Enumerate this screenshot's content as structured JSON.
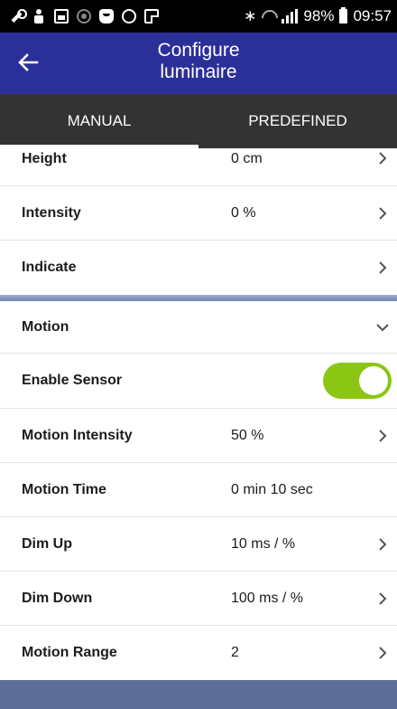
{
  "status_bar": {
    "battery": "98%",
    "time": "09:57"
  },
  "app_bar": {
    "title_line1": "Configure",
    "title_line2": "luminaire"
  },
  "tabs": [
    {
      "label": "MANUAL",
      "active": true
    },
    {
      "label": "PREDEFINED",
      "active": false
    }
  ],
  "rows": {
    "height": {
      "label": "Height",
      "value": "0 cm"
    },
    "intensity": {
      "label": "Intensity",
      "value": "0 %"
    },
    "indicate": {
      "label": "Indicate",
      "value": ""
    },
    "motion": {
      "label": "Motion"
    },
    "enable_sensor": {
      "label": "Enable Sensor",
      "enabled": true
    },
    "motion_intensity": {
      "label": "Motion Intensity",
      "value": "50 %"
    },
    "motion_time": {
      "label": "Motion Time",
      "value": "0 min 10 sec"
    },
    "dim_up": {
      "label": "Dim Up",
      "value": "10 ms / %"
    },
    "dim_down": {
      "label": "Dim Down",
      "value": "100 ms / %"
    },
    "motion_range": {
      "label": "Motion Range",
      "value": "2"
    }
  },
  "colors": {
    "app_bar": "#2b2f9a",
    "tab_bar": "#333333",
    "toggle_on": "#8cc614",
    "bottom_band": "#5d6f99"
  }
}
